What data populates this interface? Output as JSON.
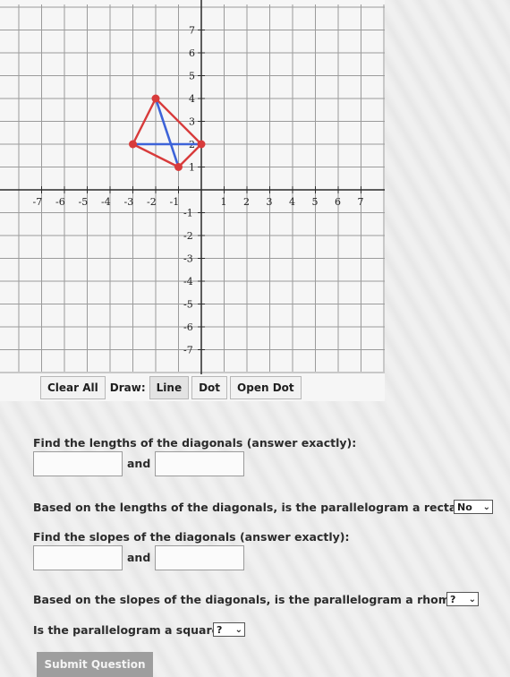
{
  "graph": {
    "x_range": [
      -7,
      7
    ],
    "y_range": [
      -7,
      7
    ],
    "x_tick_labels": [
      "-7",
      "-6",
      "-5",
      "-4",
      "-3",
      "-2",
      "-1",
      "1",
      "2",
      "3",
      "4",
      "5",
      "6",
      "7"
    ],
    "y_tick_labels": [
      "7",
      "6",
      "5",
      "4",
      "3",
      "2",
      "1",
      "-1",
      "-2",
      "-3",
      "-4",
      "-5",
      "-6",
      "-7"
    ],
    "parallelogram_points": [
      [
        -2,
        4
      ],
      [
        0,
        2
      ],
      [
        -1,
        1
      ],
      [
        -3,
        2
      ]
    ],
    "diagonal_segments": [
      [
        [
          -2,
          4
        ],
        [
          -1,
          1
        ]
      ],
      [
        [
          -3,
          2
        ],
        [
          0,
          2
        ]
      ]
    ],
    "colors": {
      "shape": "#d83b3b",
      "diagonal": "#3d63d8",
      "point": "#d83b3b",
      "axis": "#2a2a2a",
      "grid": "#9b9b9b"
    }
  },
  "toolbar": {
    "clear_all": "Clear All",
    "draw_label": "Draw:",
    "line": "Line",
    "dot": "Dot",
    "open_dot": "Open Dot"
  },
  "questions": {
    "q1": "Find the lengths of the diagonals (answer exactly):",
    "and1": "and",
    "q2": "Based on the lengths of the diagonals, is the parallelogram a rectangle?",
    "q2_select": "No",
    "q3": "Find the slopes of the diagonals (answer exactly):",
    "and2": "and",
    "q4": "Based on the slopes of the diagonals, is the parallelogram a rhombus?",
    "q4_select": "?",
    "q5": "Is the parallelogram a square?",
    "q5_select": "?"
  },
  "submit_label": "Submit Question"
}
